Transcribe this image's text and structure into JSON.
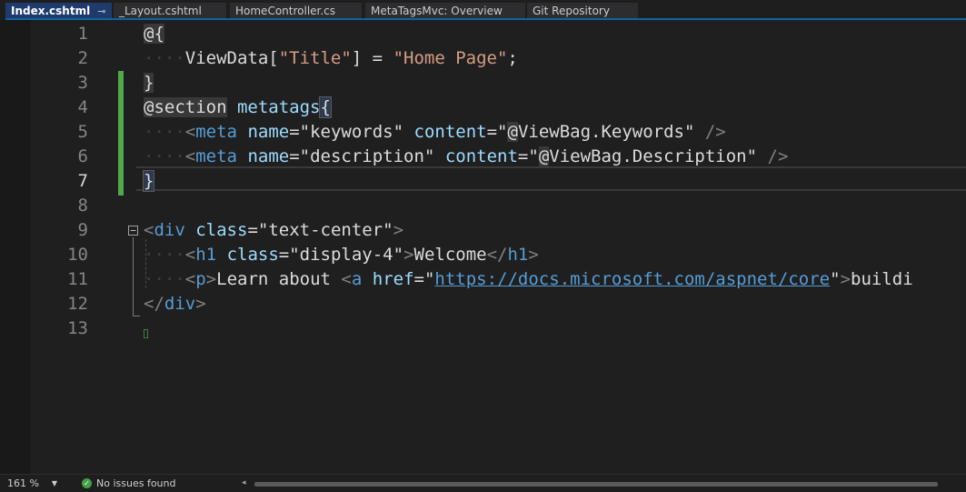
{
  "tabs": [
    {
      "label": "Index.cshtml",
      "pin": "⊸",
      "close": "✕"
    },
    {
      "label": "_Layout.cshtml"
    },
    {
      "label": "HomeController.cs"
    },
    {
      "label": "MetaTagsMvc: Overview"
    },
    {
      "label": "Git Repository"
    }
  ],
  "editor": {
    "line_numbers": [
      "1",
      "2",
      "3",
      "4",
      "5",
      "6",
      "7",
      "8",
      "9",
      "10",
      "11",
      "12",
      "13"
    ],
    "current_line": 7
  },
  "status": {
    "zoom": "161 %",
    "message": "No issues found"
  }
}
